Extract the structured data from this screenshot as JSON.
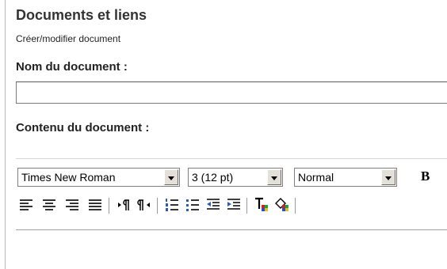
{
  "header": {
    "title": "Documents et liens",
    "subtitle": "Créer/modifier document"
  },
  "form": {
    "name_label": "Nom du document :",
    "name_value": "",
    "content_label": "Contenu du document :"
  },
  "toolbar": {
    "font_family": "Times New Roman",
    "font_size": "3 (12 pt)",
    "paragraph_style": "Normal",
    "bold_label": "B"
  },
  "icons": [
    "align-left-icon",
    "align-center-icon",
    "align-right-icon",
    "justify-icon",
    "ltr-direction-icon",
    "rtl-direction-icon",
    "ordered-list-icon",
    "unordered-list-icon",
    "outdent-icon",
    "indent-icon",
    "text-color-icon",
    "background-color-icon"
  ]
}
